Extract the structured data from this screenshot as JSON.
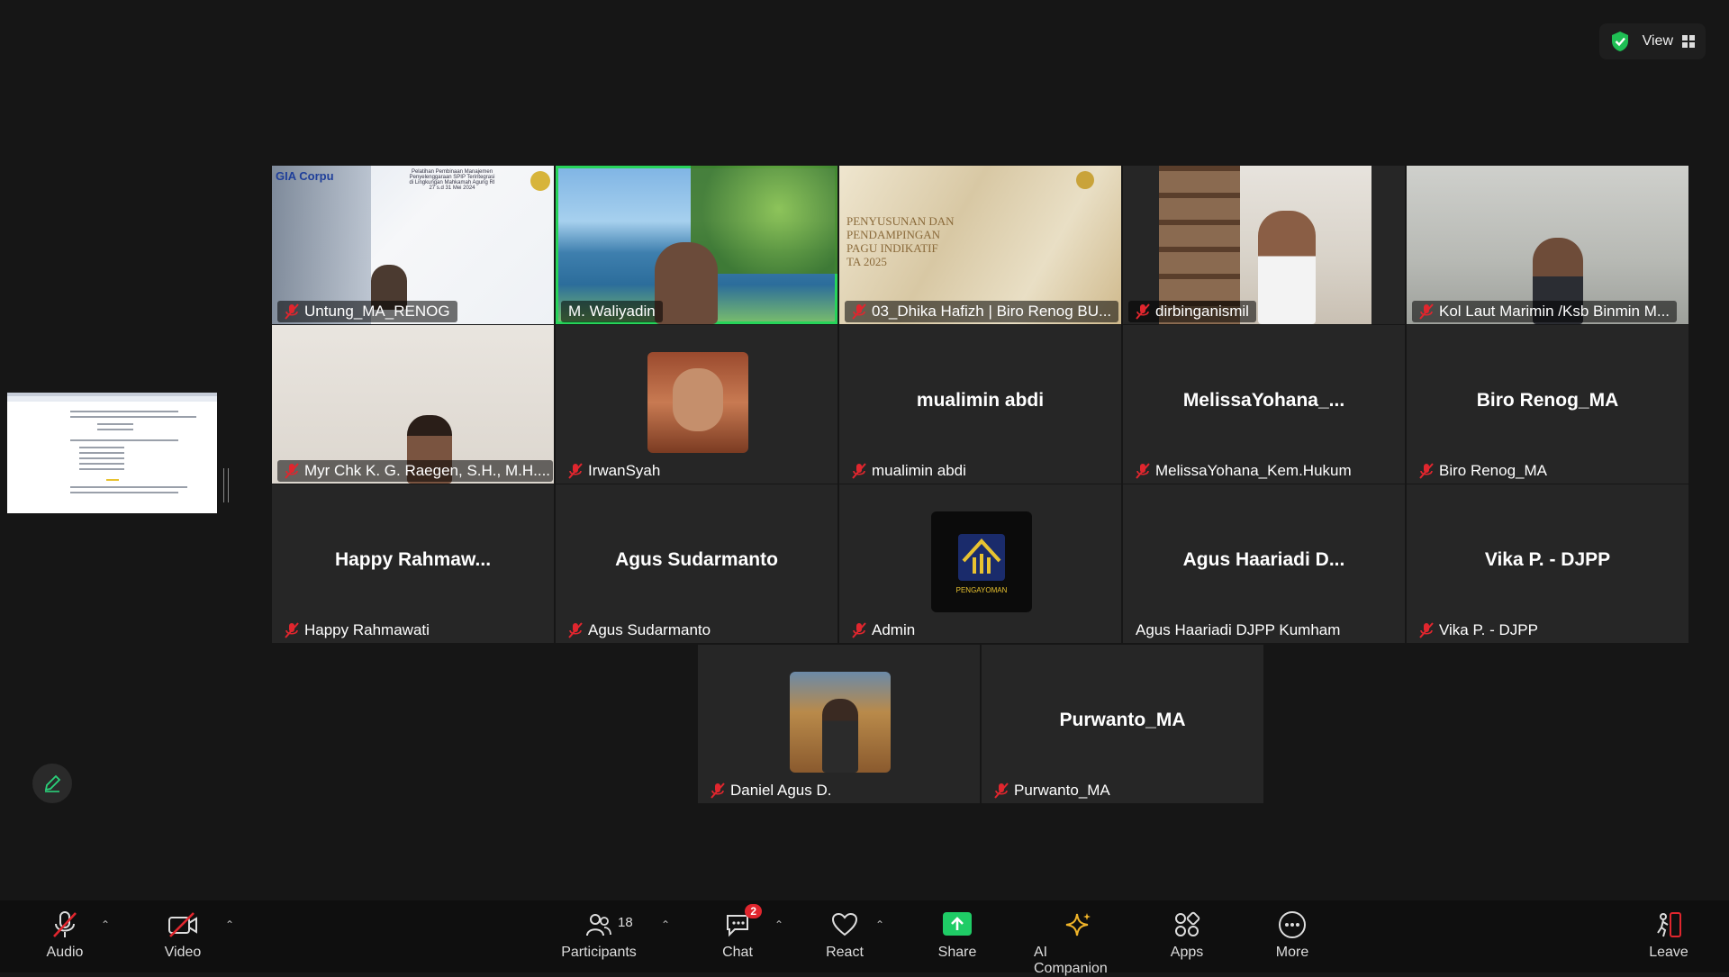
{
  "top": {
    "view_label": "View"
  },
  "participants": {
    "row1": [
      {
        "name": "Untung_MA_RENOG",
        "mic": "muted"
      },
      {
        "name": "M. Waliyadin",
        "mic": "on",
        "active": true
      },
      {
        "name": "03_Dhika Hafizh | Biro Renog BU...",
        "mic": "muted"
      },
      {
        "name": "dirbinganismil",
        "mic": "muted"
      },
      {
        "name": "Kol Laut Marimin /Ksb Binmin M...",
        "mic": "muted"
      }
    ],
    "row2": [
      {
        "name": "Myr Chk K. G. Raegen, S.H., M.H....",
        "mic": "muted"
      },
      {
        "name": "IrwanSyah",
        "mic": "muted"
      },
      {
        "display": "mualimin abdi",
        "name": "mualimin abdi",
        "mic": "muted"
      },
      {
        "display": "MelissaYohana_...",
        "name": "MelissaYohana_Kem.Hukum",
        "mic": "muted"
      },
      {
        "display": "Biro Renog_MA",
        "name": "Biro Renog_MA",
        "mic": "muted"
      }
    ],
    "row3": [
      {
        "display": "Happy  Rahmaw...",
        "name": "Happy Rahmawati",
        "mic": "muted"
      },
      {
        "display": "Agus Sudarmanto",
        "name": "Agus Sudarmanto",
        "mic": "muted"
      },
      {
        "name": "Admin",
        "mic": "muted",
        "logo_text": "PENGAYOMAN"
      },
      {
        "display": "Agus  Haariadi  D...",
        "name": "Agus Haariadi DJPP Kumham",
        "mic": "none"
      },
      {
        "display": "Vika P. - DJPP",
        "name": "Vika P. - DJPP",
        "mic": "muted"
      }
    ],
    "row4": [
      {
        "name": "Daniel Agus D.",
        "mic": "muted"
      },
      {
        "display": "Purwanto_MA",
        "name": "Purwanto_MA",
        "mic": "muted"
      }
    ]
  },
  "slides": {
    "gia_brand": "GIA Corpu",
    "gia_title_1": "Pelatihan Pembinaan Manajemen",
    "gia_title_2": "Penyelenggaraan SPIP Terintegrasi",
    "gia_title_3": "di Lingkungan Mahkamah Agung RI",
    "gia_date": "27 s.d 31 Mei 2024",
    "renog_title_1": "PENYUSUNAN DAN",
    "renog_title_2": "PENDAMPINGAN",
    "renog_title_3": "PAGU INDIKATIF",
    "renog_title_4": "TA 2025"
  },
  "toolbar": {
    "audio": "Audio",
    "video": "Video",
    "participants": "Participants",
    "participants_count": "18",
    "chat": "Chat",
    "chat_badge": "2",
    "react": "React",
    "share": "Share",
    "ai": "AI Companion",
    "apps": "Apps",
    "more": "More",
    "leave": "Leave"
  },
  "colors": {
    "active_speaker": "#27d45a",
    "muted": "#e0262e",
    "share": "#1fcc66",
    "ai": "#f0b429"
  }
}
